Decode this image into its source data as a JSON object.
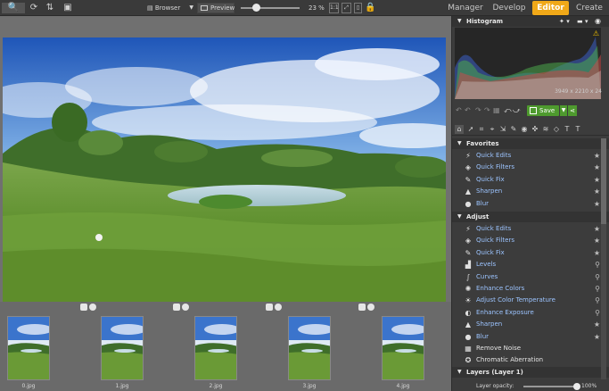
{
  "topbar": {
    "browser_label": "Browser",
    "preview_label": "Preview",
    "zoom_level": "23 %",
    "zoom_fraction": 0.25,
    "tabs": [
      {
        "label": "Manager"
      },
      {
        "label": "Develop"
      },
      {
        "label": "Editor",
        "active": true
      },
      {
        "label": "Create"
      }
    ]
  },
  "histogram": {
    "title": "Histogram",
    "dimensions": "3949 x 2210 x 24"
  },
  "toolbar": {
    "save_label": "Save"
  },
  "sections": {
    "favorites": {
      "title": "Favorites",
      "items": [
        {
          "label": "Quick Edits",
          "icon": "lightning-icon",
          "glyph": "⚡"
        },
        {
          "label": "Quick Filters",
          "icon": "cube-icon",
          "glyph": "◈"
        },
        {
          "label": "Quick Fix",
          "icon": "wrench-icon",
          "glyph": "✎"
        },
        {
          "label": "Sharpen",
          "icon": "triangle-icon",
          "glyph": "▲"
        },
        {
          "label": "Blur",
          "icon": "drop-icon",
          "glyph": "●"
        }
      ]
    },
    "adjust": {
      "title": "Adjust",
      "items": [
        {
          "label": "Quick Edits",
          "icon": "lightning-icon",
          "glyph": "⚡",
          "color": "blue",
          "mark": "star"
        },
        {
          "label": "Quick Filters",
          "icon": "cube-icon",
          "glyph": "◈",
          "color": "blue",
          "mark": "star"
        },
        {
          "label": "Quick Fix",
          "icon": "wrench-icon",
          "glyph": "✎",
          "color": "blue",
          "mark": "star"
        },
        {
          "label": "Levels",
          "icon": "levels-icon",
          "glyph": "▟",
          "color": "blue",
          "mark": "pin"
        },
        {
          "label": "Curves",
          "icon": "curves-icon",
          "glyph": "∫",
          "color": "blue",
          "mark": "pin"
        },
        {
          "label": "Enhance Colors",
          "icon": "palette-icon",
          "glyph": "✺",
          "color": "blue",
          "mark": "pin"
        },
        {
          "label": "Adjust Color Temperature",
          "icon": "bulb-icon",
          "glyph": "☀",
          "color": "blue",
          "mark": "pin"
        },
        {
          "label": "Enhance Exposure",
          "icon": "exposure-icon",
          "glyph": "◐",
          "color": "blue",
          "mark": "pin"
        },
        {
          "label": "Sharpen",
          "icon": "triangle-icon",
          "glyph": "▲",
          "color": "blue",
          "mark": "star"
        },
        {
          "label": "Blur",
          "icon": "drop-icon",
          "glyph": "●",
          "color": "blue",
          "mark": "star"
        },
        {
          "label": "Remove Noise",
          "icon": "noise-icon",
          "glyph": "▦",
          "color": "white",
          "mark": ""
        },
        {
          "label": "Chromatic Aberration",
          "icon": "aberration-icon",
          "glyph": "✪",
          "color": "white",
          "mark": ""
        }
      ]
    },
    "layers": {
      "title": "Layers (Layer 1)",
      "opacity_label": "Layer opacity:",
      "opacity_value": "100%"
    }
  },
  "filmstrip": {
    "thumbs": [
      {
        "label": "0.jpg"
      },
      {
        "label": "1.jpg"
      },
      {
        "label": "2.jpg"
      },
      {
        "label": "3.jpg"
      },
      {
        "label": "4.jpg"
      }
    ]
  },
  "colors": {
    "accent": "#f0a818",
    "save": "#4e9a2e",
    "link": "#9cc4ff"
  }
}
